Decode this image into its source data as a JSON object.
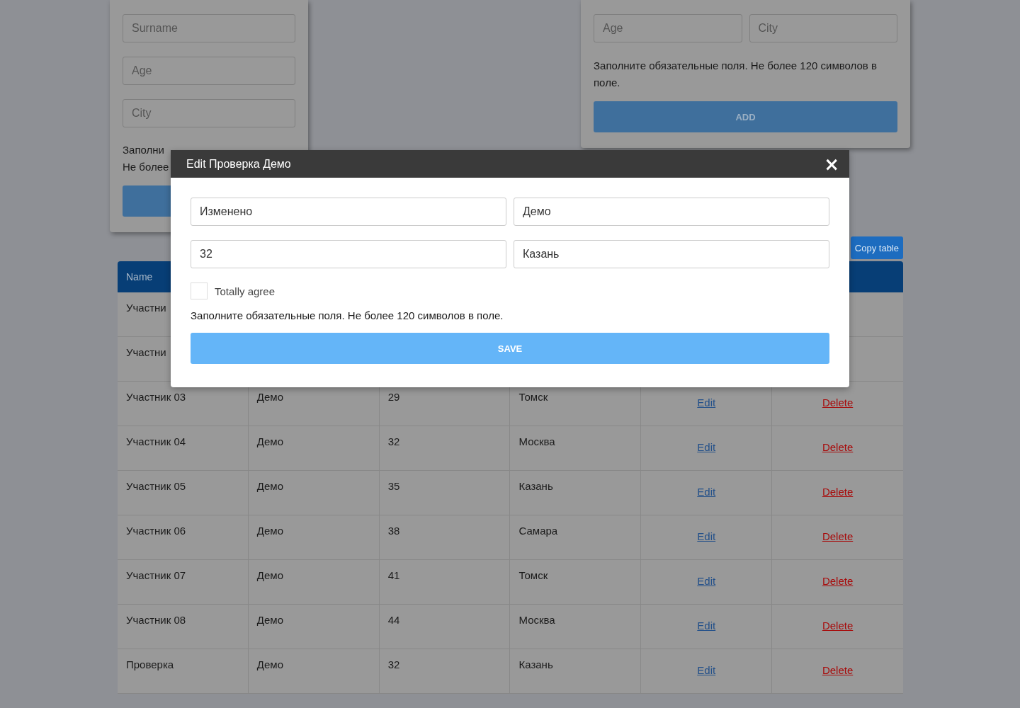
{
  "left_form": {
    "fields": [
      {
        "placeholder": "Surname"
      },
      {
        "placeholder": "Age"
      },
      {
        "placeholder": "City"
      }
    ],
    "hint_lines": [
      "Заполни",
      "Не более"
    ]
  },
  "right_form": {
    "fields": [
      {
        "placeholder": "Age"
      },
      {
        "placeholder": "City"
      }
    ],
    "hint": "Заполните обязательные поля. Не более 120 символов в поле.",
    "button": "ADD"
  },
  "copy_button": "Copy table",
  "table": {
    "columns": [
      "Name"
    ],
    "rows": [
      {
        "name": "Участни"
      },
      {
        "name": "Участни"
      },
      {
        "name": "Участник 03",
        "surname": "Демо",
        "age": "29",
        "city": "Томск",
        "edit": "Edit",
        "delete": "Delete"
      },
      {
        "name": "Участник 04",
        "surname": "Демо",
        "age": "32",
        "city": "Москва",
        "edit": "Edit",
        "delete": "Delete"
      },
      {
        "name": "Участник 05",
        "surname": "Демо",
        "age": "35",
        "city": "Казань",
        "edit": "Edit",
        "delete": "Delete"
      },
      {
        "name": "Участник 06",
        "surname": "Демо",
        "age": "38",
        "city": "Самара",
        "edit": "Edit",
        "delete": "Delete"
      },
      {
        "name": "Участник 07",
        "surname": "Демо",
        "age": "41",
        "city": "Томск",
        "edit": "Edit",
        "delete": "Delete"
      },
      {
        "name": "Участник 08",
        "surname": "Демо",
        "age": "44",
        "city": "Москва",
        "edit": "Edit",
        "delete": "Delete"
      },
      {
        "name": "Проверка",
        "surname": "Демо",
        "age": "32",
        "city": "Казань",
        "edit": "Edit",
        "delete": "Delete"
      }
    ]
  },
  "modal": {
    "title": "Edit Проверка Демо",
    "close": "×",
    "fields": [
      {
        "value": "Изменено"
      },
      {
        "value": "Демо"
      },
      {
        "value": "32"
      },
      {
        "value": "Казань"
      }
    ],
    "agree": {
      "label": "Totally agree",
      "checked": false
    },
    "hint": "Заполните обязательные поля. Не более 120 символов в поле.",
    "button": "SAVE"
  }
}
